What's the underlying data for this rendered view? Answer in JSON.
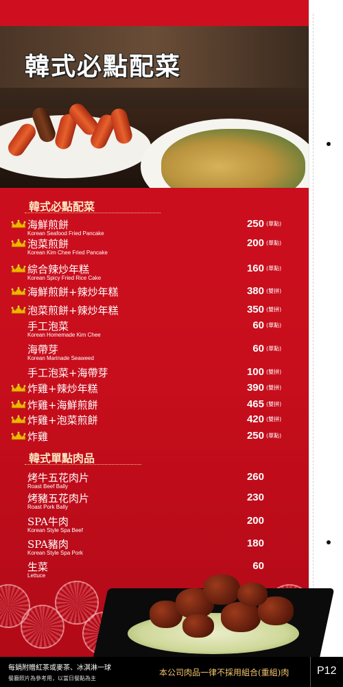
{
  "header": {
    "title": "韓式必點配菜"
  },
  "sections": [
    {
      "title": "韓式必點配菜",
      "items": [
        {
          "zh": "海鮮煎餅",
          "en": "Korean Seafood Fried Pancake",
          "price": "250",
          "note": "(單點)",
          "crown": true
        },
        {
          "zh": "泡菜煎餅",
          "en": "Korean Kim Chee Fried Pancake",
          "price": "200",
          "note": "(單點)",
          "crown": true
        },
        {
          "zh": "綜合辣炒年糕",
          "en": "Korean Spicy Fried Rice Cake",
          "price": "160",
          "note": "(單點)",
          "crown": true
        },
        {
          "zh": "海鮮煎餅+辣炒年糕",
          "en": "",
          "price": "380",
          "note": "(雙拼)",
          "crown": true
        },
        {
          "zh": "泡菜煎餅+辣炒年糕",
          "en": "",
          "price": "350",
          "note": "(雙拼)",
          "crown": true
        },
        {
          "zh": "手工泡菜",
          "en": "Korean Homemade Kim Chee",
          "price": "60",
          "note": "(單點)",
          "crown": false
        },
        {
          "zh": "海帶芽",
          "en": "Korean Marinade Seaweed",
          "price": "60",
          "note": "(單點)",
          "crown": false
        },
        {
          "zh": "手工泡菜+海帶芽",
          "en": "",
          "price": "100",
          "note": "(雙拼)",
          "crown": false
        },
        {
          "zh": "炸雞+辣炒年糕",
          "en": "",
          "price": "390",
          "note": "(雙拼)",
          "crown": true
        },
        {
          "zh": "炸雞+海鮮煎餅",
          "en": "",
          "price": "465",
          "note": "(雙拼)",
          "crown": true
        },
        {
          "zh": "炸雞+泡菜煎餅",
          "en": "",
          "price": "420",
          "note": "(雙拼)",
          "crown": true
        },
        {
          "zh": "炸雞",
          "en": "",
          "price": "250",
          "note": "(單點)",
          "crown": true
        }
      ]
    },
    {
      "title": "韓式單點肉品",
      "items": [
        {
          "zh": "烤牛五花肉片",
          "en": "Roast Beef Bally",
          "price": "260",
          "note": "",
          "crown": false
        },
        {
          "zh": "烤豬五花肉片",
          "en": "Roast Pork Bally",
          "price": "230",
          "note": "",
          "crown": false
        },
        {
          "zh": "SPA牛肉",
          "en": "Korean Style Spa Beef",
          "price": "200",
          "note": "",
          "crown": false
        },
        {
          "zh": "SPA豬肉",
          "en": "Korean Style Spa Pork",
          "price": "180",
          "note": "",
          "crown": false
        },
        {
          "zh": "生菜",
          "en": "Lettuce",
          "price": "60",
          "note": "",
          "crown": false
        }
      ]
    }
  ],
  "footer": {
    "left_line1": "每鍋附贈紅茶或麥茶、冰淇淋一球",
    "left_line2": "餐廳照片為參考用，以當日餐點為主",
    "right_text": "本公司肉品一律不採用組合(重組)肉",
    "page": "P12"
  },
  "icons": {
    "crown": "crown-icon"
  },
  "colors": {
    "panel_red": "#cf0f1f",
    "title_gold": "#fbe6c2",
    "crown_gold": "#f2b400",
    "footer_accent": "#f4c46a"
  }
}
